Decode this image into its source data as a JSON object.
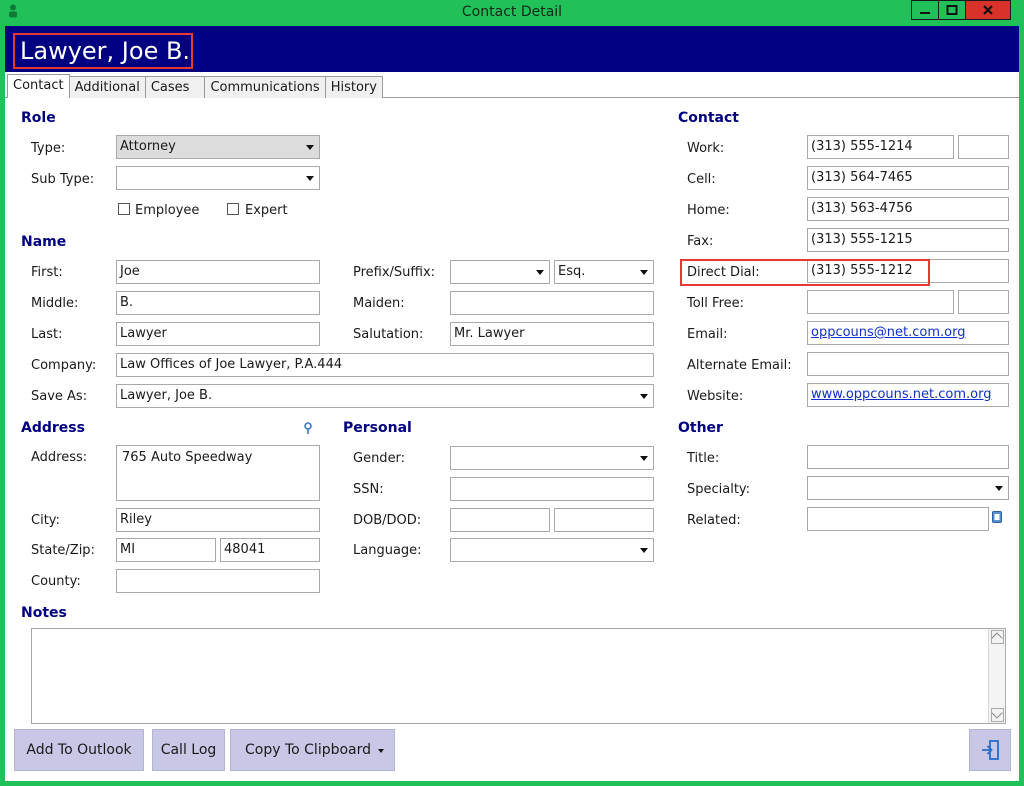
{
  "window": {
    "title": "Contact Detail"
  },
  "header": {
    "name": "Lawyer, Joe B."
  },
  "tabs": [
    {
      "label": "Contact"
    },
    {
      "label": "Additional"
    },
    {
      "label": "Cases"
    },
    {
      "label": "Communications"
    },
    {
      "label": "History"
    }
  ],
  "role": {
    "section": "Role",
    "type_label": "Type:",
    "type_value": "Attorney",
    "subtype_label": "Sub Type:",
    "subtype_value": "",
    "employee_label": "Employee",
    "employee_checked": false,
    "expert_label": "Expert",
    "expert_checked": false
  },
  "name": {
    "section": "Name",
    "first_label": "First:",
    "first_value": "Joe",
    "middle_label": "Middle:",
    "middle_value": "B.",
    "last_label": "Last:",
    "last_value": "Lawyer",
    "company_label": "Company:",
    "company_value": "Law Offices of Joe Lawyer, P.A.444",
    "saveas_label": "Save As:",
    "saveas_value": "Lawyer, Joe B.",
    "prefix_label": "Prefix/Suffix:",
    "prefix_value": "",
    "suffix_value": "Esq.",
    "maiden_label": "Maiden:",
    "maiden_value": "",
    "salutation_label": "Salutation:",
    "salutation_value": "Mr. Lawyer"
  },
  "address": {
    "section": "Address",
    "address_label": "Address:",
    "address_value": "765 Auto Speedway",
    "city_label": "City:",
    "city_value": "Riley",
    "statezip_label": "State/Zip:",
    "state_value": "MI",
    "zip_value": "48041",
    "county_label": "County:",
    "county_value": ""
  },
  "personal": {
    "section": "Personal",
    "gender_label": "Gender:",
    "gender_value": "",
    "ssn_label": "SSN:",
    "ssn_value": "",
    "dob_label": "DOB/DOD:",
    "dob_value": "",
    "dod_value": "",
    "language_label": "Language:",
    "language_value": ""
  },
  "contact": {
    "section": "Contact",
    "work_label": "Work:",
    "work_value": "(313) 555-1214",
    "work_ext": "",
    "cell_label": "Cell:",
    "cell_value": "(313) 564-7465",
    "home_label": "Home:",
    "home_value": "(313) 563-4756",
    "fax_label": "Fax:",
    "fax_value": "(313) 555-1215",
    "direct_label": "Direct Dial:",
    "direct_value": "(313) 555-1212",
    "tollfree_label": "Toll Free:",
    "tollfree_value": "",
    "tollfree_ext": "",
    "email_label": "Email:",
    "email_value": "oppcouns@net.com.org",
    "altemail_label": "Alternate Email:",
    "altemail_value": "",
    "website_label": "Website:",
    "website_value": "www.oppcouns.net.com.org"
  },
  "other": {
    "section": "Other",
    "title_label": "Title:",
    "title_value": "",
    "specialty_label": "Specialty:",
    "specialty_value": "",
    "related_label": "Related:",
    "related_value": ""
  },
  "notes": {
    "section": "Notes",
    "value": ""
  },
  "buttons": {
    "add_outlook": "Add To Outlook",
    "call_log": "Call Log",
    "copy_clipboard": "Copy To Clipboard"
  },
  "colors": {
    "titlebar": "#21c15a",
    "header": "#000080",
    "section_text": "#000080",
    "button": "#c8c8e6",
    "highlight": "#e53935"
  }
}
